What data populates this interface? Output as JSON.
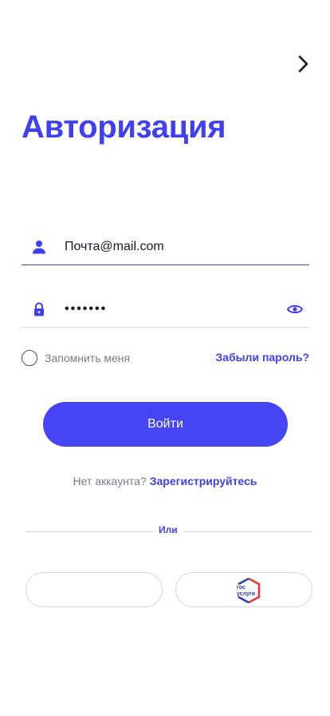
{
  "header": {
    "title": "Авторизация",
    "next_icon": "chevron-right-icon"
  },
  "form": {
    "email": {
      "icon": "user-icon",
      "value": "Почта@mail.com"
    },
    "password": {
      "icon": "lock-icon",
      "value": "•••••••",
      "toggle_icon": "eye-icon"
    },
    "remember_label": "Запомнить меня",
    "remember_checked": false,
    "forgot_link": "Забыли пароль?",
    "login_button": "Войти"
  },
  "register": {
    "prompt": "Нет аккаунта?",
    "link": "Зарегистрируйтесь"
  },
  "divider": {
    "label": "Или"
  },
  "social": {
    "left_button": "",
    "gosuslugi_logo": {
      "line1": "гос",
      "line2": "услуги"
    }
  },
  "colors": {
    "accent": "#4040F2",
    "muted_text": "#7A7A86",
    "border": "#D8D8DE"
  }
}
